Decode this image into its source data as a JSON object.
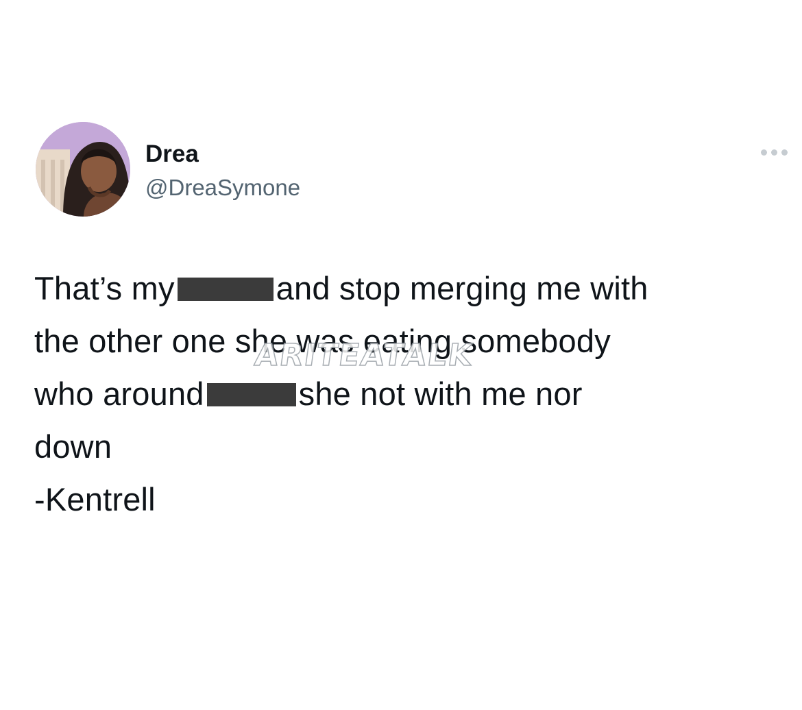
{
  "tweet": {
    "author": {
      "display_name": "Drea",
      "handle": "@DreaSymone",
      "avatar_icon": "profile-photo-avatar"
    },
    "more_icon": "ellipsis-icon",
    "text_lines": [
      [
        "That’s my ",
        "REDACTED",
        "and stop merging me with"
      ],
      [
        "the other one she was eating somebody"
      ],
      [
        "who  around",
        "REDACTED",
        "she not with me nor"
      ],
      [
        "down"
      ],
      [
        "-Kentrell"
      ]
    ],
    "line_1_start": "That’s my",
    "line_1_end": "and stop merging me with",
    "line_2": "the other one she was eating somebody",
    "line_3_start": "who  around",
    "line_3_end": "she not with me nor",
    "line_4": "down",
    "line_5": "-Kentrell"
  },
  "watermark": {
    "text": "ARITEATALK"
  },
  "colors": {
    "background": "#ffffff",
    "text_primary": "#0f1419",
    "text_secondary": "#536471",
    "redaction": "#3b3b3b",
    "menu_dots": "#c6ccd1"
  }
}
